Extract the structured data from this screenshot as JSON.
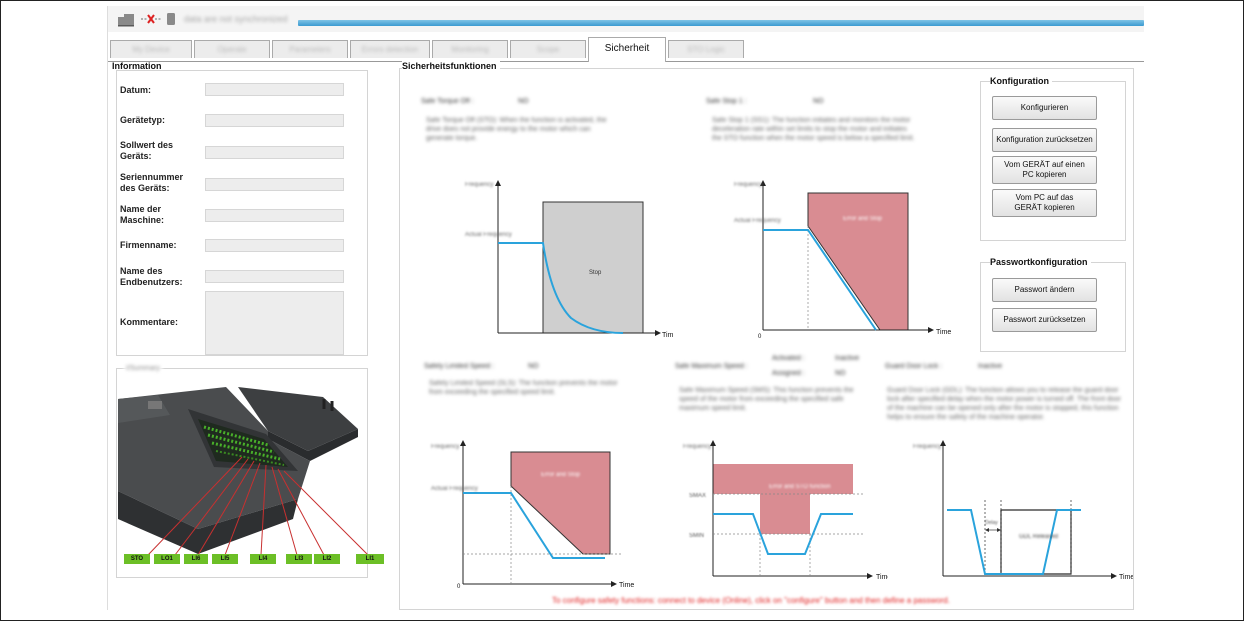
{
  "header": {
    "status_text": "data are not synchronized",
    "colors": {
      "sync_bar": "#3a9ad0"
    }
  },
  "tabs": [
    {
      "label": "My Device"
    },
    {
      "label": "Operate"
    },
    {
      "label": "Parameters"
    },
    {
      "label": "Errors detection"
    },
    {
      "label": "Monitoring"
    },
    {
      "label": "Scope"
    },
    {
      "label": "Sicherheit"
    },
    {
      "label": "STO Logic"
    }
  ],
  "information": {
    "title": "Information",
    "fields": [
      {
        "label": "Datum:"
      },
      {
        "label": "Gerätetyp:"
      },
      {
        "label": "Sollwert des Geräts:"
      },
      {
        "label": "Seriennummer des Geräts:"
      },
      {
        "label": "Name der Maschine:"
      },
      {
        "label": "Firmenname:"
      },
      {
        "label": "Name des Endbenutzers:"
      },
      {
        "label": "Kommentare:"
      }
    ]
  },
  "summary": {
    "title": "I/Summary",
    "labels": [
      "STO",
      "LO1",
      "LI6",
      "LI5",
      "LI4",
      "LI3",
      "LI2",
      "LI1"
    ],
    "colors": {
      "label_bg": "#6cbf26",
      "line": "#c83030"
    }
  },
  "safety": {
    "title": "Sicherheitsfunktionen",
    "functions": [
      {
        "name": "Safe Torque Off :",
        "value": "NO",
        "desc": "Safe Torque Off (STO): When the function is activated, the drive does not provide energy to the motor which can generate torque."
      },
      {
        "name": "Safe Stop 1 :",
        "value": "NO",
        "desc": "Safe Stop 1 (SS1): The function initiates and monitors the motor deceleration rate within set limits to stop the motor and initiates the STO function when the motor speed is below a specified limit."
      },
      {
        "name": "Safely Limited Speed :",
        "value": "NO",
        "desc": "Safely Limited Speed (SLS): The function prevents the motor from exceeding the specified speed limit."
      },
      {
        "name": "Safe Maximum Speed :",
        "activated_label": "Activated :",
        "activated_value": "Inactive",
        "assigned_label": "Assigned :",
        "assigned_value": "NO",
        "desc": "Safe Maximum Speed (SMS): This function prevents the speed of the motor from exceeding the specified safe maximum speed limit."
      },
      {
        "name": "Guard Door Lock :",
        "value": "Inactive",
        "desc": "Guard Door Lock (GDL): The function allows you to release the guard door lock after specified delay when the motor power is turned off. The front door of the machine can be opened only after the motor is stopped, this function helps to ensure the safety of the machine operator."
      }
    ],
    "charts": {
      "frequency": "Frequency",
      "time": "Time",
      "actual_frequency": "Actual Frequency",
      "stop": "Stop",
      "error_stop": "Error and Stop",
      "error_sto": "Error and STO function",
      "smax": "SMAX",
      "smin": "SMIN",
      "delay": "Delay",
      "gdl_released": "GDL Released",
      "zero": "0",
      "colors": {
        "curve": "#2aa3dc",
        "error_fill": "#d98c92",
        "stop_fill": "#cfcfcf"
      }
    },
    "warning": "To configure safety functions: connect to device (Online), click on \"configure\" button and then define a password."
  },
  "konfiguration": {
    "title": "Konfiguration",
    "buttons": [
      {
        "label": "Konfigurieren"
      },
      {
        "label": "Konfiguration zurücksetzen"
      },
      {
        "label": "Vom GERÄT auf einen PC kopieren"
      },
      {
        "label": "Vom PC auf das GERÄT kopieren"
      }
    ]
  },
  "passwort": {
    "title": "Passwortkonfiguration",
    "buttons": [
      {
        "label": "Passwort ändern"
      },
      {
        "label": "Passwort zurücksetzen"
      }
    ]
  }
}
